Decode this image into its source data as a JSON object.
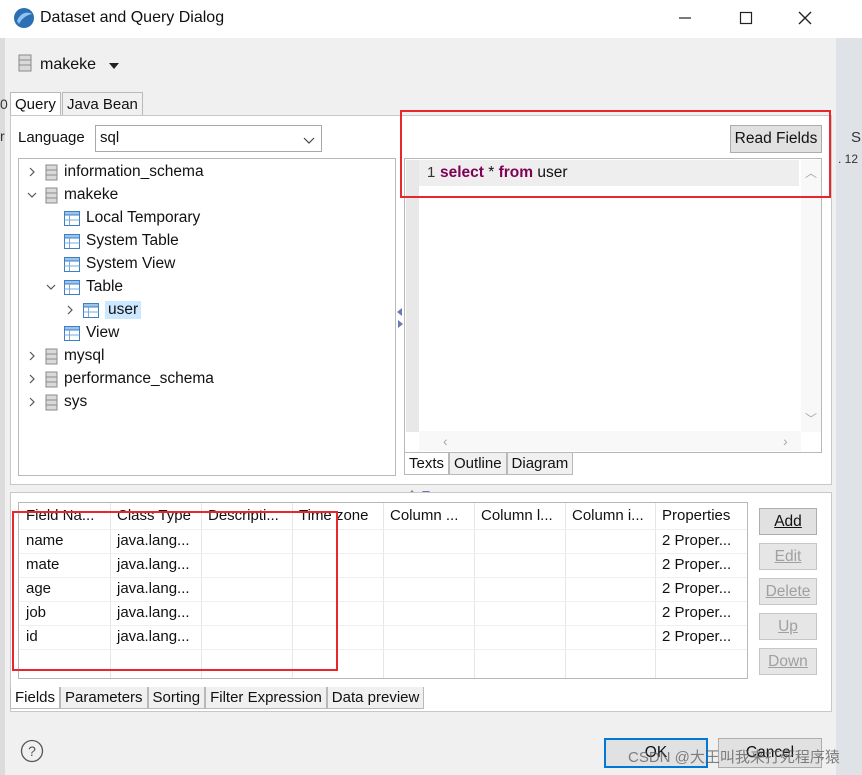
{
  "window": {
    "title": "Dataset and Query Dialog",
    "minimize": "—",
    "maximize": "☐",
    "close": "✕"
  },
  "datasource": {
    "name": "makeke"
  },
  "tabs": [
    {
      "label": "Query",
      "active": true
    },
    {
      "label": "Java Bean",
      "active": false
    }
  ],
  "language": {
    "label": "Language",
    "value": "sql"
  },
  "tree": [
    {
      "label": "information_schema",
      "level": 0,
      "toggle": "collapsed",
      "icon": "database-icon"
    },
    {
      "label": "makeke",
      "level": 0,
      "toggle": "expanded",
      "icon": "database-icon"
    },
    {
      "label": "Local Temporary",
      "level": 1,
      "toggle": "none",
      "icon": "table-icon"
    },
    {
      "label": "System Table",
      "level": 1,
      "toggle": "none",
      "icon": "table-icon"
    },
    {
      "label": "System View",
      "level": 1,
      "toggle": "none",
      "icon": "table-icon"
    },
    {
      "label": "Table",
      "level": 1,
      "toggle": "expanded",
      "icon": "table-icon"
    },
    {
      "label": "user",
      "level": 2,
      "toggle": "collapsed",
      "icon": "table-icon",
      "selected": true
    },
    {
      "label": "View",
      "level": 1,
      "toggle": "none",
      "icon": "table-icon"
    },
    {
      "label": "mysql",
      "level": 0,
      "toggle": "collapsed",
      "icon": "database-icon"
    },
    {
      "label": "performance_schema",
      "level": 0,
      "toggle": "collapsed",
      "icon": "database-icon"
    },
    {
      "label": "sys",
      "level": 0,
      "toggle": "collapsed",
      "icon": "database-icon"
    }
  ],
  "editor": {
    "read_fields_label": "Read Fields",
    "line_number": "1",
    "code": [
      {
        "text": "select",
        "keyword": true
      },
      {
        "text": " * ",
        "keyword": false
      },
      {
        "text": "from",
        "keyword": true
      },
      {
        "text": " user",
        "keyword": false
      }
    ],
    "tabs": [
      "Texts",
      "Outline",
      "Diagram"
    ]
  },
  "fields_table": {
    "columns": [
      "Field Na...",
      "Class Type",
      "Descripti...",
      "Time zone",
      "Column ...",
      "Column l...",
      "Column i...",
      "Properties"
    ],
    "rows": [
      [
        "name",
        "java.lang...",
        "",
        "",
        "",
        "",
        "",
        "2 Proper..."
      ],
      [
        "mate",
        "java.lang...",
        "",
        "",
        "",
        "",
        "",
        "2 Proper..."
      ],
      [
        "age",
        "java.lang...",
        "",
        "",
        "",
        "",
        "",
        "2 Proper..."
      ],
      [
        "job",
        "java.lang...",
        "",
        "",
        "",
        "",
        "",
        "2 Proper..."
      ],
      [
        "id",
        "java.lang...",
        "",
        "",
        "",
        "",
        "",
        "2 Proper..."
      ]
    ]
  },
  "side_buttons": [
    {
      "label": "Add",
      "enabled": true
    },
    {
      "label": "Edit",
      "enabled": false
    },
    {
      "label": "Delete",
      "enabled": false
    },
    {
      "label": "Up",
      "enabled": false
    },
    {
      "label": "Down",
      "enabled": false
    }
  ],
  "bottom_tabs": [
    "Fields",
    "Parameters",
    "Sorting",
    "Filter Expression",
    "Data preview"
  ],
  "buttons": {
    "ok": "OK",
    "cancel": "Cancel"
  },
  "help": "?",
  "watermark": "CSDN @大王叫我来打死程序猿",
  "background_fragments": {
    "left": "0",
    "left2": "r",
    "right": "S",
    "right2": ". 12"
  },
  "colors": {
    "accent": "#0078d7",
    "annotation": "#e8262d",
    "selection": "#cce8ff",
    "keyword": "#7f0055"
  }
}
